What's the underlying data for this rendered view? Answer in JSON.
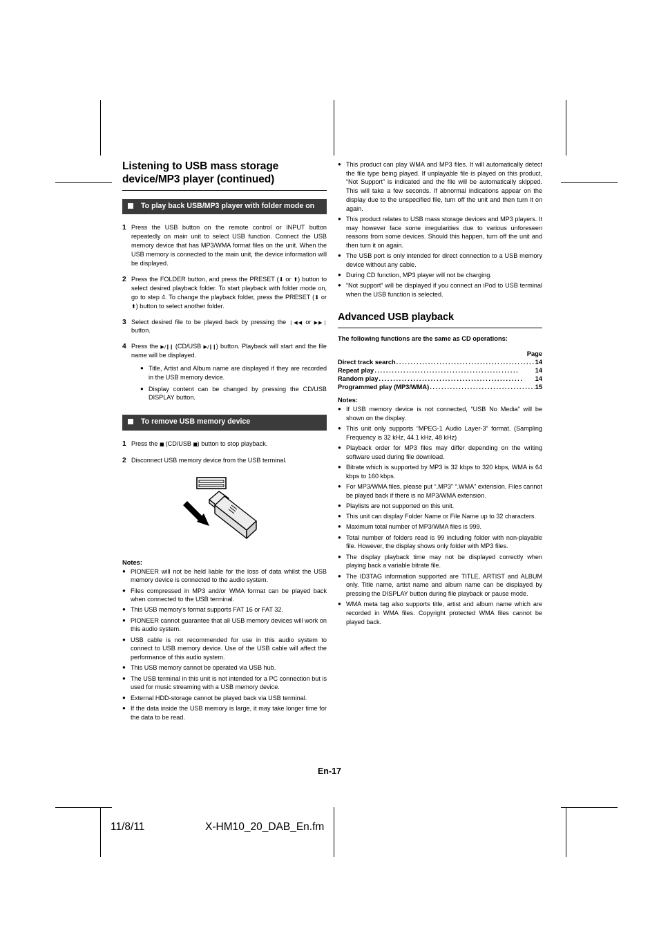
{
  "document": {
    "folio": "En-17",
    "footer_date": "11/8/11",
    "footer_filename": "X-HM10_20_DAB_En.fm"
  },
  "left_column": {
    "title": "Listening to USB mass storage device/MP3 player (continued)",
    "banner_1": "To play back USB/MP3 player with folder mode on",
    "steps": [
      {
        "num": "1",
        "text": "Press the USB button on the remote control or INPUT button repeatedly on main unit to select USB function. Connect the USB memory device that has MP3/WMA format files on the unit. When the USB memory is connected to the main unit, the device information will be displayed."
      },
      {
        "num": "2",
        "text_a": "Press the FOLDER button, and press the PRESET (",
        "text_b": " or ",
        "text_c": ") button to select desired playback folder. To start playback with folder mode on, go to step 4. To change the playback folder, press the PRESET (",
        "text_d": " or ",
        "text_e": ") button to select another folder."
      },
      {
        "num": "3",
        "text_a": "Select desired file to be played back by pressing the ",
        "text_b": " or ",
        "text_c": " button."
      },
      {
        "num": "4",
        "text_a": "Press the ",
        "text_b": " (CD/USB ",
        "text_c": ") button. Playback will start and the file name will be displayed.",
        "sub_bullets": [
          "Title, Artist and Album name are displayed if they are recorded in the USB memory device.",
          "Display content can be changed by pressing the CD/USB DISPLAY button."
        ]
      }
    ],
    "banner_2": "To remove USB memory device",
    "remove_steps": [
      {
        "num": "1",
        "text_a": "Press the ",
        "text_b": " (CD/USB ",
        "text_c": ") button to stop playback."
      },
      {
        "num": "2",
        "text_a": "Disconnect USB memory device from the USB terminal."
      }
    ],
    "notes_label": "Notes:",
    "notes": [
      "PIONEER will not be held liable for the loss of data whilst the USB memory device is connected to the audio system.",
      "Files compressed in MP3 and/or WMA format can be played back when connected to the USB terminal.",
      "This USB memory's format supports FAT 16 or FAT 32.",
      "PIONEER cannot guarantee that all USB memory devices will work on this audio system.",
      "USB cable is not recommended for use in this audio system to connect to USB memory device. Use of the USB cable will affect the performance of this audio system.",
      "This USB memory cannot be operated via USB hub.",
      "The USB terminal in this unit is not intended for a PC connection but is used for music streaming with a USB memory device.",
      "External HDD-storage cannot be played back via USB terminal.",
      "If the data inside the USB memory is large, it may take longer time for the data to be read."
    ]
  },
  "right_column": {
    "top_bullets": [
      "This product can play WMA and MP3 files. It will automatically detect the file type being played. If unplayable file is played on this product, “Not Support” is indicated and the file will be automatically skipped. This will take a few seconds. If abnormal indications appear on the display due to the unspecified file, turn off the unit and then turn it on again.",
      "This product relates to USB mass storage devices and MP3 players. It may however face some irregularities due to various unforeseen reasons from some devices. Should this happen, turn off the unit and then turn it on again.",
      "The USB port is only intended for direct connection to a USB memory device without any cable.",
      "During CD function, MP3 player will not be charging.",
      "“Not support” will be displayed if you connect an iPod to USB terminal when the USB function is selected."
    ],
    "title": "Advanced USB playback",
    "intro": "The following functions are the same as CD operations:",
    "page_header": "Page",
    "toc": [
      {
        "label": "Direct track search",
        "page": "14"
      },
      {
        "label": "Repeat play",
        "page": "14"
      },
      {
        "label": "Random play",
        "page": "14"
      },
      {
        "label": "Programmed play (MP3/WMA)",
        "page": "15"
      }
    ],
    "notes_label": "Notes:",
    "notes": [
      "If USB memory device is not connected, “USB No Media” will be shown on the display.",
      "This unit only supports “MPEG-1 Audio Layer-3” format. (Sampling Frequency is 32 kHz, 44.1 kHz, 48 kHz)",
      "Playback order for MP3 files may differ depending on the writing software used during file download.",
      "Bitrate which is supported by MP3 is 32 kbps to 320 kbps, WMA is 64 kbps to 160 kbps.",
      "For MP3/WMA files, please put “.MP3” “.WMA” extension. Files cannot be played back if there is no MP3/WMA extension.",
      "Playlists are not supported on this unit.",
      "This unit can display Folder Name or File Name up to 32 characters.",
      "Maximum total number of MP3/WMA files is 999.",
      "Total number of folders read is 99 including folder with non-playable file. However, the display shows only folder with MP3 files.",
      "The display playback time may not be displayed correctly when playing back a variable bitrate file.",
      "The ID3TAG information supported are TITLE, ARTIST and ALBUM only. Title name, artist name and album name can be displayed by pressing the DISPLAY button during file playback or pause mode.",
      "WMA meta tag also supports title, artist and album name which are recorded in WMA files. Copyright protected WMA files cannot be played back."
    ]
  },
  "symbols": {
    "bullet": "●",
    "preset_down": "⬇",
    "preset_up": "⬆",
    "skip_prev": "❘◀◀",
    "skip_next": "▶▶❘",
    "play_pause": "▶/❙❙",
    "stop": "■"
  },
  "figure": {
    "name": "usb-removal-illustration",
    "caption": ""
  },
  "colors": {
    "banner_bg": "#3b3b3b",
    "banner_text": "#ffffff",
    "page_bg": "#ffffff",
    "text": "#000000"
  }
}
